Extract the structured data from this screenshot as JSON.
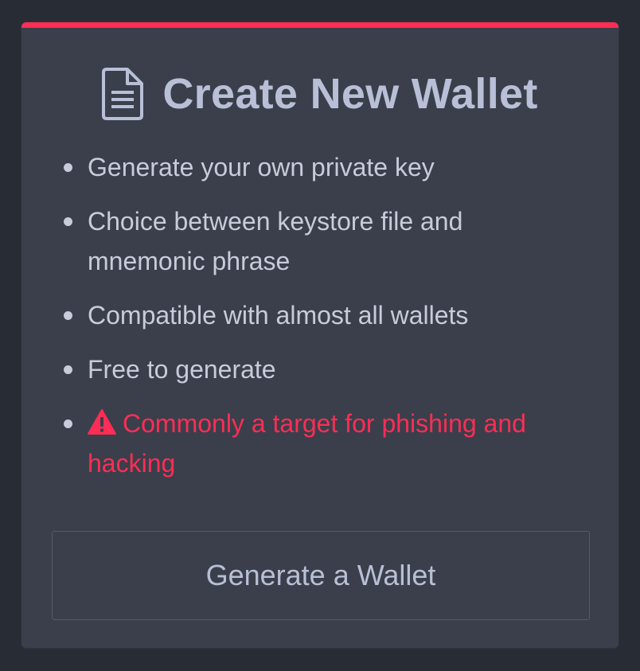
{
  "card": {
    "title": "Create New Wallet",
    "title_icon": "document-icon",
    "accent_color": "#ff2d55",
    "features": [
      "Generate your own private key",
      "Choice between keystore file and mnemonic phrase",
      "Compatible with almost all wallets",
      "Free to generate"
    ],
    "warning": {
      "icon": "warning-triangle-icon",
      "text": "Commonly a target for phishing and hacking",
      "color": "#ff2d55"
    },
    "button_label": "Generate a Wallet"
  }
}
